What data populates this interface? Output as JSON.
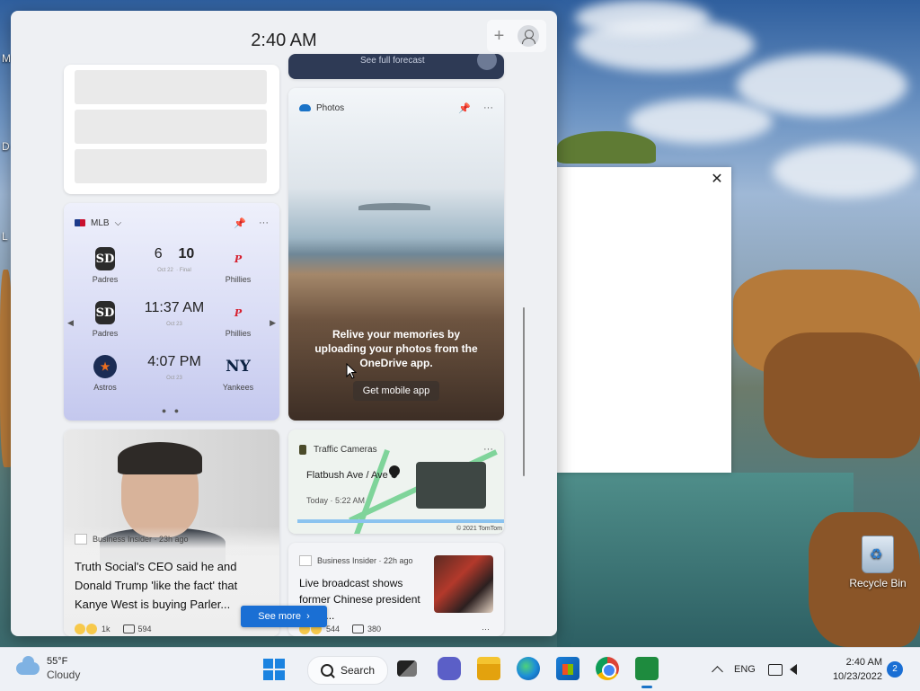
{
  "panel": {
    "time": "2:40 AM"
  },
  "top_right_card": {
    "text": "See full forecast"
  },
  "mlb": {
    "title": "MLB",
    "games": [
      {
        "home": "Padres",
        "away": "Phillies",
        "home_score": "6",
        "away_score": "10",
        "date": "Oct 22",
        "status": "Final"
      },
      {
        "home": "Padres",
        "away": "Phillies",
        "time": "11:37 AM",
        "date": "Oct 23"
      },
      {
        "home": "Astros",
        "away": "Yankees",
        "time": "4:07 PM",
        "date": "Oct 23"
      }
    ]
  },
  "photos": {
    "title": "Photos",
    "message": "Relive your memories by uploading your photos from the OneDrive app.",
    "button": "Get mobile app"
  },
  "news1": {
    "source": "Business Insider · 23h ago",
    "headline": "Truth Social's CEO said he and Donald Trump 'like the fact' that Kanye West is buying Parler...",
    "reactions": "1k",
    "comments": "594"
  },
  "see_more": "See more",
  "traffic": {
    "title": "Traffic Cameras",
    "location": "Flatbush Ave / Ave U",
    "when": "Today · 5:22 AM",
    "copyright": "© 2021 TomTom"
  },
  "news2": {
    "source": "Business Insider · 22h ago",
    "headline": "Live broadcast shows former Chinese president being...",
    "reactions": "544",
    "comments": "380"
  },
  "desktop": {
    "recycle_bin": "Recycle Bin"
  },
  "taskbar": {
    "temperature": "55°F",
    "condition": "Cloudy",
    "search": "Search",
    "language": "ENG",
    "time": "2:40 AM",
    "date": "10/23/2022",
    "notifications": "2"
  }
}
